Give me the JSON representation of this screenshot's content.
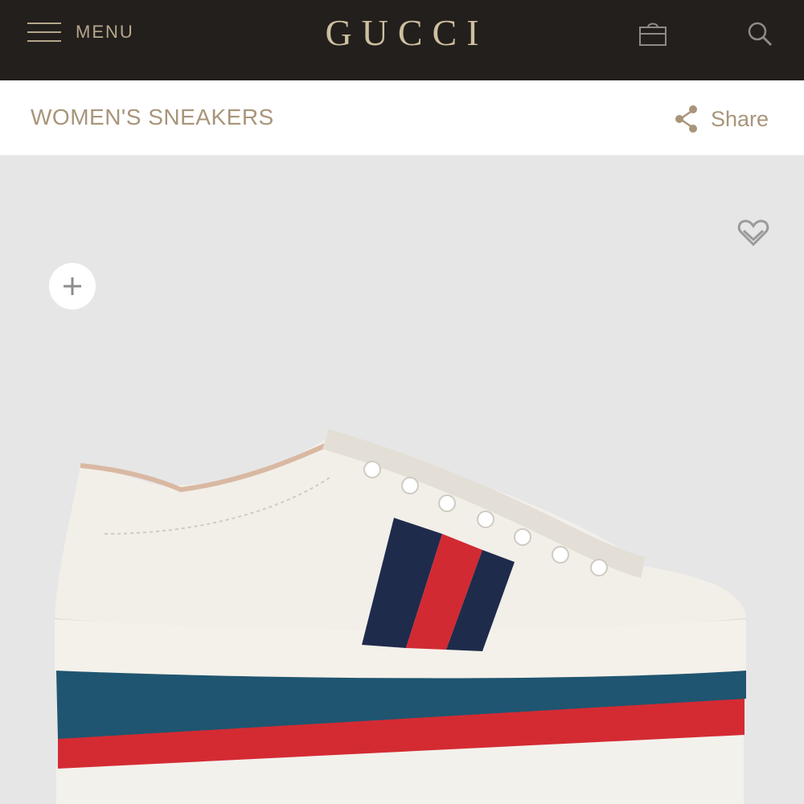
{
  "header": {
    "menu_label": "MENU",
    "logo_text": "GUCCI",
    "icons": [
      "hamburger-icon",
      "shopping-bag-icon",
      "search-icon"
    ]
  },
  "subheader": {
    "category": "WOMEN'S SNEAKERS",
    "share_label": "Share"
  },
  "product": {
    "image": "white leather platform sneaker with blue-red-blue web stripe and striped sole",
    "icons": [
      "plus-icon",
      "heart-icon"
    ]
  },
  "colors": {
    "topbar": "#231f1c",
    "gold": "#cdbf9f",
    "text_gold": "#a8957a",
    "image_bg": "#e6e6e6",
    "navy": "#1d2a4a",
    "red": "#d22a33",
    "teal": "#1e5670"
  }
}
